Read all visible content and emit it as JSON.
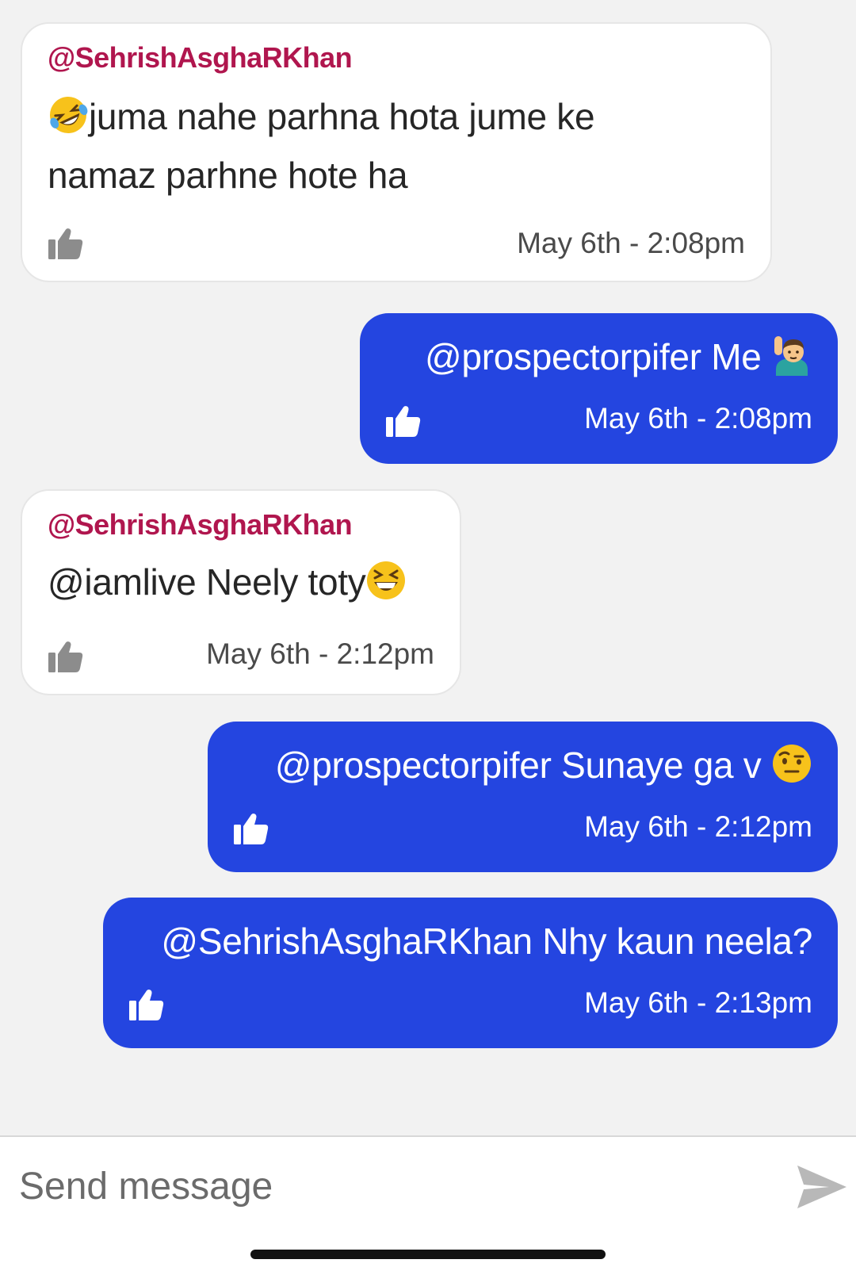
{
  "messages": [
    {
      "direction": "incoming",
      "sender": "@SehrishAsghaRKhan",
      "text_lines": [
        "juma nahe parhna hota jume ke",
        "namaz parhne hote ha"
      ],
      "leading_emoji": "rolling-on-floor-laughing",
      "time": "May 6th - 2:08pm"
    },
    {
      "direction": "outgoing",
      "text": "@prospectorpifer Me ",
      "trailing_emoji": "man-raising-hand",
      "time": "May 6th - 2:08pm"
    },
    {
      "direction": "incoming",
      "sender": "@SehrishAsghaRKhan",
      "text": "@iamlive Neely toty",
      "trailing_emoji": "grinning-squinting-face",
      "time": "May 6th - 2:12pm"
    },
    {
      "direction": "outgoing",
      "text": "@prospectorpifer Sunaye ga v ",
      "trailing_emoji": "face-with-raised-eyebrow",
      "time": "May 6th - 2:12pm"
    },
    {
      "direction": "outgoing",
      "text": "@SehrishAsghaRKhan Nhy kaun neela?",
      "time": "May 6th - 2:13pm"
    }
  ],
  "composer": {
    "placeholder": "Send message",
    "send_icon": "send-arrow-icon"
  },
  "colors": {
    "outgoing_bubble": "#2445e0",
    "incoming_bubble": "#ffffff",
    "sender_name": "#b0164e",
    "background": "#f2f2f2"
  }
}
